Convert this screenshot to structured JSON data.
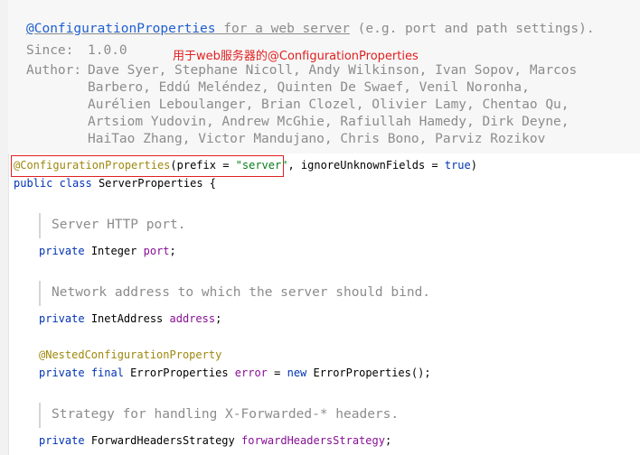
{
  "doc": {
    "line1_annotation": "@ConfigurationProperties",
    "line1_middle": " for a web server",
    "line1_rest": " (e.g. port and path settings).",
    "since_label": "Since:",
    "since_value": "1.0.0",
    "note": "用于web服务器的@ConfigurationProperties",
    "author_label": "Author:",
    "authors": [
      "Dave Syer, Stephane Nicoll, Andy Wilkinson, Ivan Sopov, Marcos",
      "Barbero, Eddú Meléndez, Quinten De Swaef, Venil Noronha,",
      "Aurélien Leboulanger, Brian Clozel, Olivier Lamy, Chentao Qu,",
      "Artsiom Yudovin, Andrew McGhie, Rafiullah Hamedy, Dirk Deyne,",
      "HaiTao Zhang, Victor Mandujano, Chris Bono, Parviz Rozikov"
    ]
  },
  "code": {
    "ann_name": "@ConfigurationProperties",
    "ann_open": "(prefix = ",
    "ann_prefix_value": "\"server\"",
    "ann_comma": ",",
    "ann_ignore": " ignoreUnknownFields = ",
    "ann_true": "true",
    "ann_close": ")",
    "class_kw1": "public",
    "class_kw2": "class",
    "class_name": "ServerProperties {",
    "comment_port": "Server HTTP port.",
    "port_kw": "private",
    "port_type": "Integer",
    "port_name": "port",
    "semi": ";",
    "comment_address": "Network address to which the server should bind.",
    "address_kw": "private",
    "address_type": "InetAddress",
    "address_name": "address",
    "nested_ann": "@NestedConfigurationProperty",
    "error_kw1": "private",
    "error_kw2": "final",
    "error_type": "ErrorProperties",
    "error_name": "error",
    "error_eq": " = ",
    "error_new": "new",
    "error_ctor": "ErrorProperties();",
    "comment_forward": "Strategy for handling X-Forwarded-* headers.",
    "fwd_kw": "private",
    "fwd_type": "ForwardHeadersStrategy",
    "fwd_name": "forwardHeadersStrategy"
  }
}
